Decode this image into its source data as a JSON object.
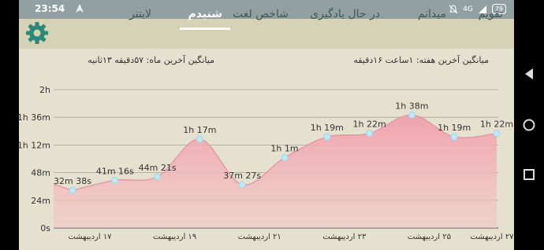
{
  "status_bar": {
    "time": "23:54",
    "battery": "79",
    "network": "4G"
  },
  "tabs": [
    {
      "label": "تقویم",
      "active": false
    },
    {
      "label": "میدانم",
      "active": false
    },
    {
      "label": "در حال یادگیری",
      "active": false
    },
    {
      "label": "شاخص لغت",
      "active": false
    },
    {
      "label": "شنیدم",
      "active": true
    },
    {
      "label": "لایتنر",
      "active": false
    }
  ],
  "summary": {
    "week_average": "میانگین آخرین هفته: ۱ساعت ۱۶دقیقه",
    "month_average": "میانگین آخرین ماه: ۵۷دقیقه ۱۳ثانیه"
  },
  "icons": {
    "settings": "gear-icon",
    "back": "back-triangle-icon",
    "home": "home-circle-icon",
    "recents": "recents-square-icon"
  },
  "colors": {
    "accent": "#2b8a77",
    "area_fill": "#f0a9b3",
    "point": "#bfe8f5"
  },
  "chart_data": {
    "type": "area",
    "y_unit": "minutes",
    "ylim": [
      0,
      120
    ],
    "y_ticks": [
      {
        "value": 0,
        "label": "0s"
      },
      {
        "value": 24,
        "label": "24m"
      },
      {
        "value": 48,
        "label": "48m"
      },
      {
        "value": 72,
        "label": "1h 12m"
      },
      {
        "value": 96,
        "label": "1h 36m"
      },
      {
        "value": 120,
        "label": "2h"
      }
    ],
    "x_tick_labels": [
      "۱۷ اردیبهشت",
      "۱۹ اردیبهشت",
      "۲۱ اردیبهشت",
      "۲۳ اردیبهشت",
      "۲۵ اردیبهشت",
      "۲۷ اردیبهشت"
    ],
    "points": [
      {
        "value": 32.6,
        "label": "32m 38s"
      },
      {
        "value": 41.3,
        "label": "41m 16s"
      },
      {
        "value": 44.4,
        "label": "44m 21s"
      },
      {
        "value": 77,
        "label": "1h 17m"
      },
      {
        "value": 37.5,
        "label": "37m 27s"
      },
      {
        "value": 61,
        "label": "1h 1m"
      },
      {
        "value": 79,
        "label": "1h 19m"
      },
      {
        "value": 82,
        "label": "1h 22m"
      },
      {
        "value": 98,
        "label": "1h 38m"
      },
      {
        "value": 79,
        "label": "1h 19m"
      },
      {
        "value": 82,
        "label": "1h 22m"
      }
    ],
    "grid": true
  }
}
